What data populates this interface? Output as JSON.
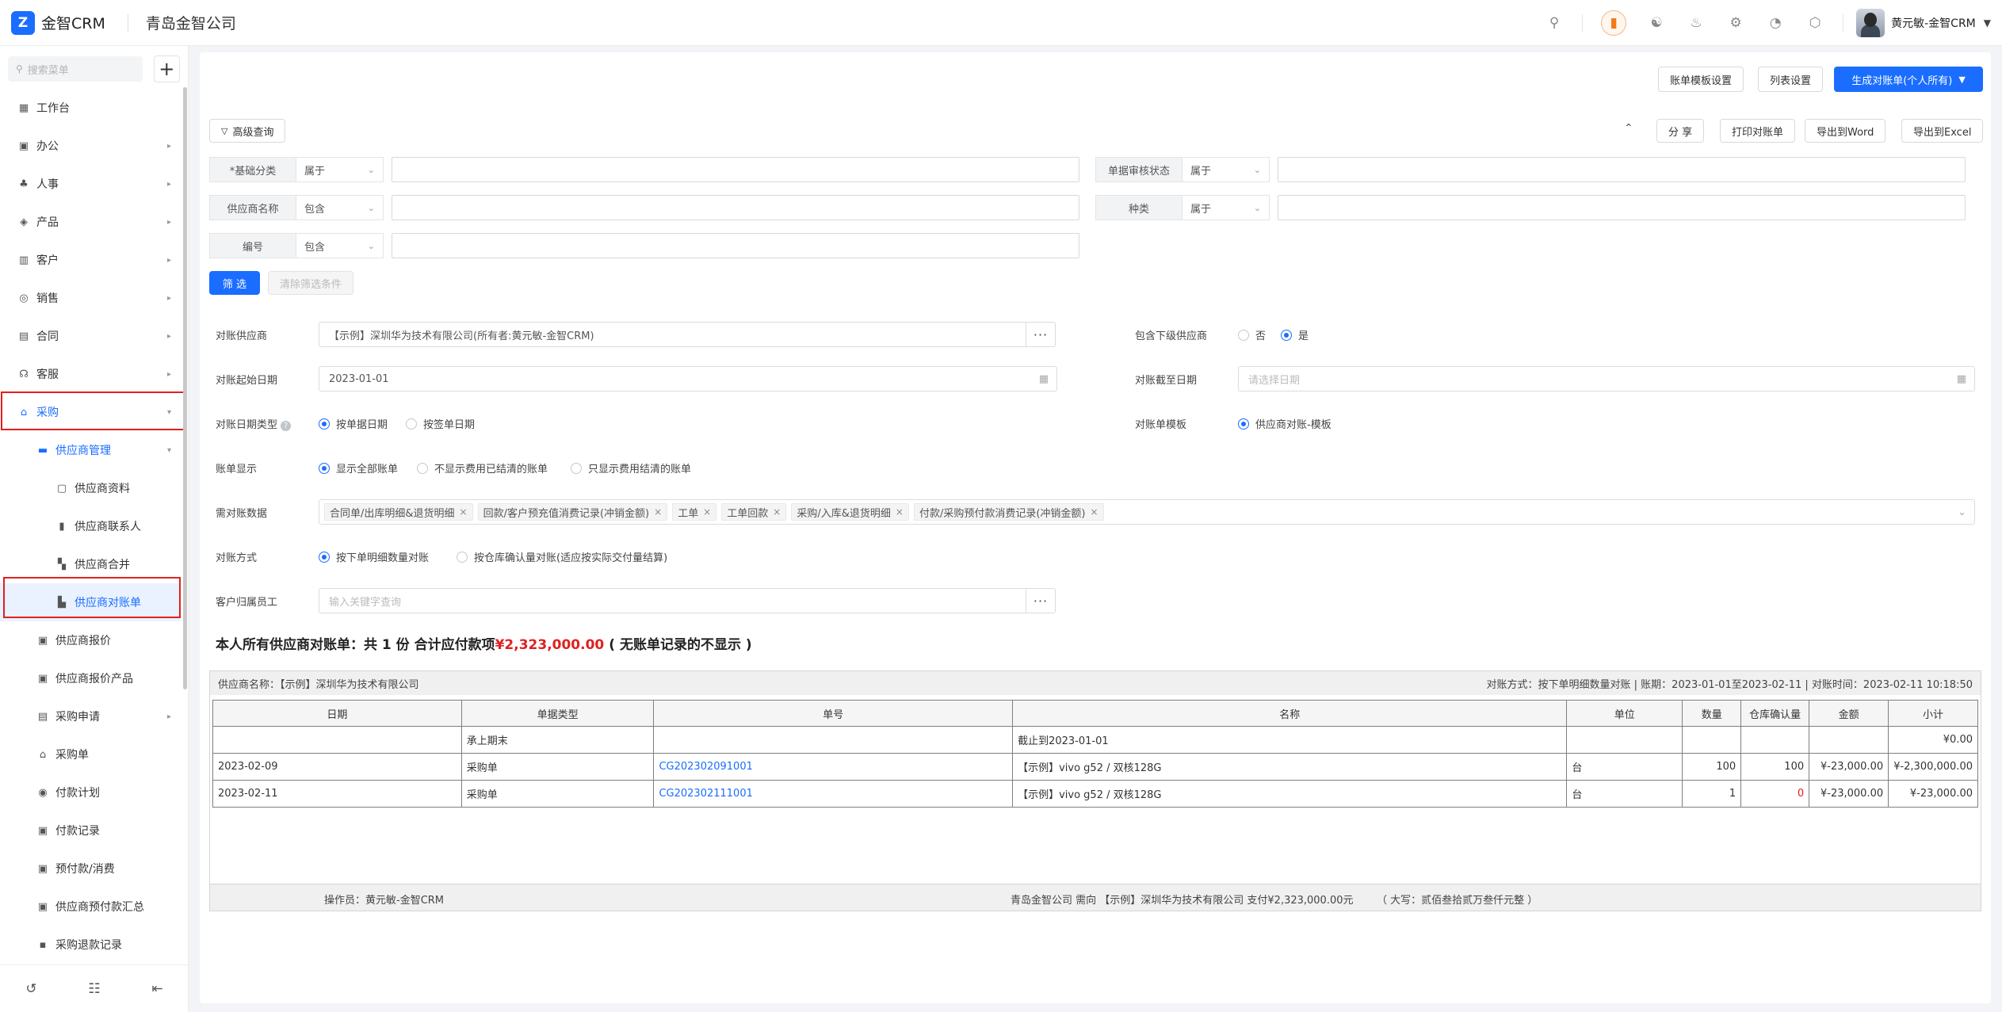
{
  "app": {
    "logo_mark": "Z",
    "name": "金智CRM",
    "company": "青岛金智公司"
  },
  "topbar": {
    "user_name": "黄元敏-金智CRM",
    "icons": [
      "search-icon",
      "notice-icon",
      "contacts-icon",
      "bell-icon",
      "gear-icon",
      "pie-chart-icon",
      "box-icon"
    ]
  },
  "sidebar": {
    "search_placeholder": "搜索菜单",
    "items": [
      {
        "label": "工作台",
        "icon": "▦"
      },
      {
        "label": "办公",
        "icon": "▣"
      },
      {
        "label": "人事",
        "icon": "♣"
      },
      {
        "label": "产品",
        "icon": "◈"
      },
      {
        "label": "客户",
        "icon": "▥"
      },
      {
        "label": "销售",
        "icon": "◎"
      },
      {
        "label": "合同",
        "icon": "▤"
      },
      {
        "label": "客服",
        "icon": "☊"
      },
      {
        "label": "采购",
        "icon": "⌂"
      },
      {
        "label": "供应商管理",
        "icon": "▬"
      },
      {
        "label": "供应商资料",
        "icon": "▢"
      },
      {
        "label": "供应商联系人",
        "icon": "▮"
      },
      {
        "label": "供应商合并",
        "icon": "▚"
      },
      {
        "label": "供应商对账单",
        "icon": "▙"
      },
      {
        "label": "供应商报价",
        "icon": "▣"
      },
      {
        "label": "供应商报价产品",
        "icon": "▣"
      },
      {
        "label": "采购申请",
        "icon": "▤"
      },
      {
        "label": "采购单",
        "icon": "⌂"
      },
      {
        "label": "付款计划",
        "icon": "◉"
      },
      {
        "label": "付款记录",
        "icon": "▣"
      },
      {
        "label": "预付款/消费",
        "icon": "▣"
      },
      {
        "label": "供应商预付款汇总",
        "icon": "▣"
      },
      {
        "label": "采购退款记录",
        "icon": "▪"
      }
    ]
  },
  "toolbar": {
    "template_settings": "账单模板设置",
    "list_settings": "列表设置",
    "generate": "生成对账单(个人所有)",
    "advanced_query": "高级查询",
    "share": "分 享",
    "print": "打印对账单",
    "export_word": "导出到Word",
    "export_excel": "导出到Excel"
  },
  "filters": {
    "basic_category": {
      "label": "*基础分类",
      "op": "属于"
    },
    "audit_status": {
      "label": "单据审核状态",
      "op": "属于"
    },
    "supplier_name": {
      "label": "供应商名称",
      "op": "包含"
    },
    "kind": {
      "label": "种类",
      "op": "属于"
    },
    "number": {
      "label": "编号",
      "op": "包含"
    },
    "filter_btn": "筛 选",
    "clear_btn": "清除筛选条件"
  },
  "form": {
    "supplier_label": "对账供应商",
    "supplier_value": "【示例】深圳华为技术有限公司(所有者:黄元敏-金智CRM)",
    "include_sub_label": "包含下级供应商",
    "include_no": "否",
    "include_yes": "是",
    "start_label": "对账起始日期",
    "start_value": "2023-01-01",
    "end_label": "对账截至日期",
    "end_placeholder": "请选择日期",
    "datetype_label": "对账日期类型",
    "datetype_opt1": "按单据日期",
    "datetype_opt2": "按签单日期",
    "template_label": "对账单模板",
    "template_opt": "供应商对账-模板",
    "display_label": "账单显示",
    "display_opt1": "显示全部账单",
    "display_opt2": "不显示费用已结清的账单",
    "display_opt3": "只显示费用结清的账单",
    "data_label": "需对账数据",
    "data_tags": [
      "合同单/出库明细&退货明细",
      "回款/客户预充值消费记录(冲销金额)",
      "工单",
      "工单回款",
      "采购/入库&退货明细",
      "付款/采购预付款消费记录(冲销金额)"
    ],
    "method_label": "对账方式",
    "method_opt1": "按下单明细数量对账",
    "method_opt2": "按仓库确认量对账(适应按实际交付量结算)",
    "owner_label": "客户归属员工",
    "owner_placeholder": "输入关键字查询"
  },
  "summary": {
    "prefix": "本人所有供应商对账单：共 1 份   合计应付款项",
    "amount": "¥2,323,000.00",
    "suffix": "( 无账单记录的不显示 )"
  },
  "statement": {
    "supplier": "供应商名称：【示例】深圳华为技术有限公司",
    "meta": "对账方式：按下单明细数量对账  |  账期：2023-01-01至2023-02-11  |  对账时间：2023-02-11 10:18:50",
    "columns": [
      "日期",
      "单据类型",
      "单号",
      "名称",
      "单位",
      "数量",
      "仓库确认量",
      "金额",
      "小计"
    ],
    "rows": [
      {
        "date": "",
        "type": "承上期末",
        "no": "",
        "name": "截止到2023-01-01",
        "unit": "",
        "qty": "",
        "confirm": "",
        "amount": "",
        "subtotal": "¥0.00"
      },
      {
        "date": "2023-02-09",
        "type": "采购单",
        "no": "CG202302091001",
        "name": "【示例】vivo g52 / 双核128G",
        "unit": "台",
        "qty": "100",
        "confirm": "100",
        "amount": "¥-23,000.00",
        "subtotal": "¥-2,300,000.00"
      },
      {
        "date": "2023-02-11",
        "type": "采购单",
        "no": "CG202302111001",
        "name": "【示例】vivo g52 / 双核128G",
        "unit": "台",
        "qty": "1",
        "confirm": "0",
        "amount": "¥-23,000.00",
        "subtotal": "¥-23,000.00"
      }
    ],
    "operator": "操作员：黄元敏-金智CRM",
    "pay_note": "青岛金智公司 需向 【示例】深圳华为技术有限公司 支付¥2,323,000.00元",
    "capital": "（ 大写：贰佰叁拾贰万叁仟元整 ）"
  }
}
